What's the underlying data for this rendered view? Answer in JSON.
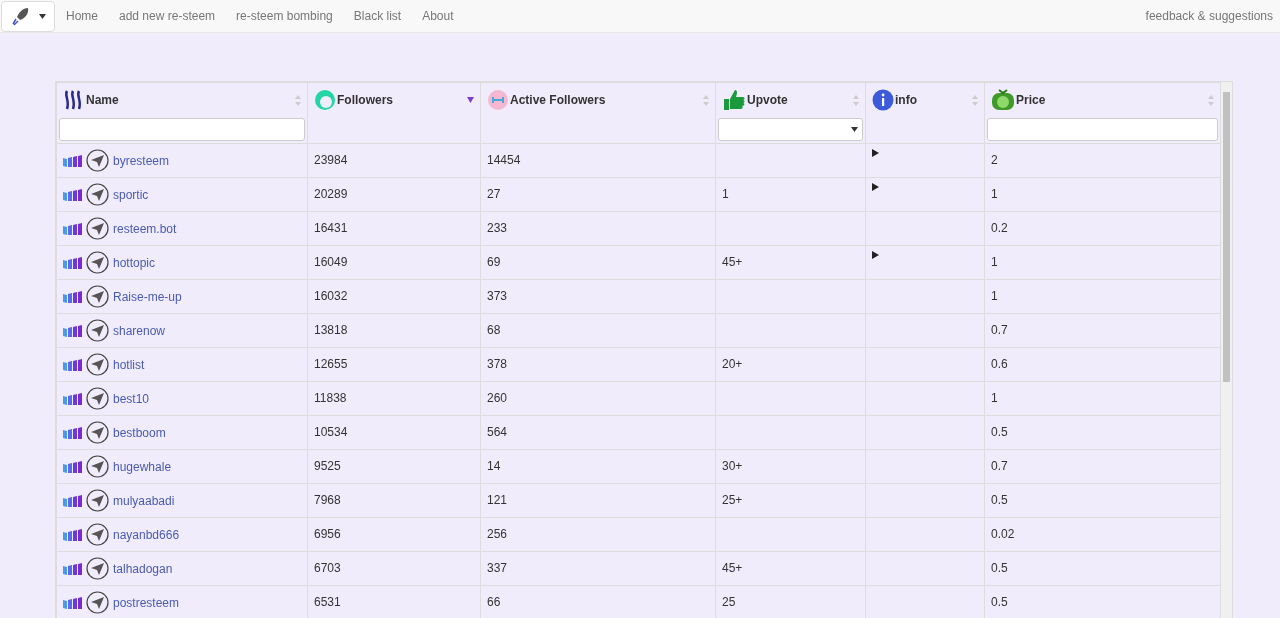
{
  "nav": {
    "items": [
      "Home",
      "add new re-steem",
      "re-steem bombing",
      "Black list",
      "About"
    ],
    "right": "feedback & suggestions"
  },
  "columns": [
    {
      "kind": "name",
      "label": "Name",
      "text_filter": true,
      "dropdown_filter": false,
      "sorted": false
    },
    {
      "kind": "followers",
      "label": "Followers",
      "text_filter": false,
      "dropdown_filter": false,
      "sorted": true
    },
    {
      "kind": "active",
      "label": "Active Followers",
      "text_filter": false,
      "dropdown_filter": false,
      "sorted": false
    },
    {
      "kind": "upvote",
      "label": "Upvote",
      "text_filter": false,
      "dropdown_filter": true,
      "sorted": false
    },
    {
      "kind": "info",
      "label": "info",
      "text_filter": false,
      "dropdown_filter": false,
      "sorted": false
    },
    {
      "kind": "price",
      "label": "Price",
      "text_filter": true,
      "dropdown_filter": false,
      "sorted": false
    }
  ],
  "rows": [
    {
      "name": "byresteem",
      "followers": "23984",
      "active": "14454",
      "upvote": "",
      "expandable": true,
      "price": "2"
    },
    {
      "name": "sportic",
      "followers": "20289",
      "active": "27",
      "upvote": "1",
      "expandable": true,
      "price": "1"
    },
    {
      "name": "resteem.bot",
      "followers": "16431",
      "active": "233",
      "upvote": "",
      "expandable": false,
      "price": "0.2"
    },
    {
      "name": "hottopic",
      "followers": "16049",
      "active": "69",
      "upvote": "45+",
      "expandable": true,
      "price": "1"
    },
    {
      "name": "Raise-me-up",
      "followers": "16032",
      "active": "373",
      "upvote": "",
      "expandable": false,
      "price": "1"
    },
    {
      "name": "sharenow",
      "followers": "13818",
      "active": "68",
      "upvote": "",
      "expandable": false,
      "price": "0.7"
    },
    {
      "name": "hotlist",
      "followers": "12655",
      "active": "378",
      "upvote": "20+",
      "expandable": false,
      "price": "0.6"
    },
    {
      "name": "best10",
      "followers": "11838",
      "active": "260",
      "upvote": "",
      "expandable": false,
      "price": "1"
    },
    {
      "name": "bestboom",
      "followers": "10534",
      "active": "564",
      "upvote": "",
      "expandable": false,
      "price": "0.5"
    },
    {
      "name": "hugewhale",
      "followers": "9525",
      "active": "14",
      "upvote": "30+",
      "expandable": false,
      "price": "0.7"
    },
    {
      "name": "mulyaabadi",
      "followers": "7968",
      "active": "121",
      "upvote": "25+",
      "expandable": false,
      "price": "0.5"
    },
    {
      "name": "nayanbd666",
      "followers": "6956",
      "active": "256",
      "upvote": "",
      "expandable": false,
      "price": "0.02"
    },
    {
      "name": "talhadogan",
      "followers": "6703",
      "active": "337",
      "upvote": "45+",
      "expandable": false,
      "price": "0.5"
    },
    {
      "name": "postresteem",
      "followers": "6531",
      "active": "66",
      "upvote": "25",
      "expandable": false,
      "price": "0.5"
    }
  ]
}
